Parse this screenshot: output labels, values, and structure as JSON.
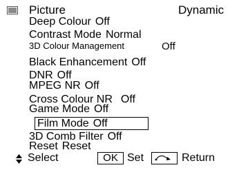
{
  "header": {
    "title": "Picture",
    "mode": "Dynamic"
  },
  "items": [
    {
      "label": "Deep Colour",
      "value": "Off"
    },
    {
      "label": "Contrast Mode",
      "value": "Normal"
    },
    {
      "label": "3D Colour Management",
      "value": "Off"
    },
    {
      "label": "Black Enhancement",
      "value": "Off"
    },
    {
      "label": "DNR",
      "value": "Off"
    },
    {
      "label": "MPEG NR",
      "value": "Off"
    },
    {
      "label": "Cross Colour NR",
      "value": "Off"
    },
    {
      "label": "Game Mode",
      "value": "Off"
    },
    {
      "label": "Film Mode",
      "value": "Off"
    },
    {
      "label": "3D Comb Filter",
      "value": "Off"
    },
    {
      "label": "Reset",
      "value": "Reset"
    }
  ],
  "footer": {
    "select_label": "Select",
    "ok_label": "OK",
    "set_label": "Set",
    "return_label": "Return"
  },
  "icons": {
    "menu": "tv-menu-icon",
    "updown": "up-down-arrows-icon",
    "return": "return-icon"
  }
}
